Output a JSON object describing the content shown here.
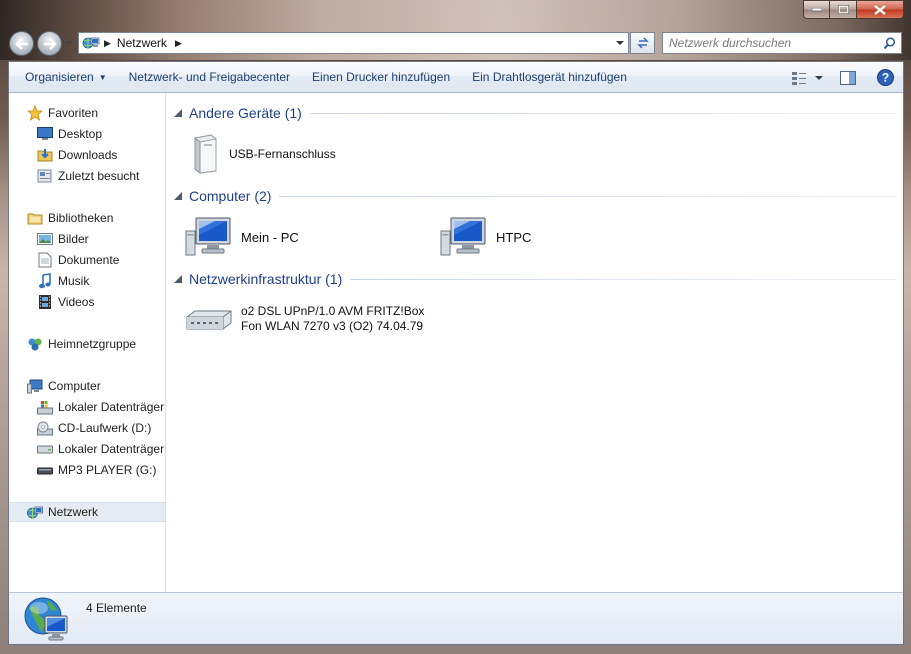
{
  "window": {
    "caption_buttons": [
      "minimize",
      "maximize",
      "close"
    ]
  },
  "address_bar": {
    "location": "Netzwerk"
  },
  "search": {
    "placeholder": "Netzwerk durchsuchen"
  },
  "command_bar": {
    "organize": "Organisieren",
    "network_sharing": "Netzwerk- und Freigabecenter",
    "add_printer": "Einen Drucker hinzufügen",
    "add_wireless": "Ein Drahtlosgerät hinzufügen"
  },
  "nav_pane": {
    "favorites": {
      "label": "Favoriten",
      "items": [
        {
          "label": "Desktop",
          "icon": "desktop-icon"
        },
        {
          "label": "Downloads",
          "icon": "downloads-icon"
        },
        {
          "label": "Zuletzt besucht",
          "icon": "recent-places-icon"
        }
      ]
    },
    "libraries": {
      "label": "Bibliotheken",
      "items": [
        {
          "label": "Bilder",
          "icon": "pictures-icon"
        },
        {
          "label": "Dokumente",
          "icon": "documents-icon"
        },
        {
          "label": "Musik",
          "icon": "music-icon"
        },
        {
          "label": "Videos",
          "icon": "videos-icon"
        }
      ]
    },
    "homegroup": {
      "label": "Heimnetzgruppe"
    },
    "computer": {
      "label": "Computer",
      "items": [
        {
          "label": "Lokaler Datenträger",
          "icon": "windows-drive-icon"
        },
        {
          "label": "CD-Laufwerk (D:)",
          "icon": "cd-drive-icon"
        },
        {
          "label": "Lokaler Datenträger",
          "icon": "hard-drive-icon"
        },
        {
          "label": "MP3 PLAYER (G:)",
          "icon": "removable-drive-icon"
        }
      ]
    },
    "network": {
      "label": "Netzwerk",
      "selected": true
    }
  },
  "content": {
    "groups": [
      {
        "title": "Andere Geräte (1)",
        "items": [
          {
            "label": "USB-Fernanschluss",
            "icon": "usb-device-icon"
          }
        ]
      },
      {
        "title": "Computer (2)",
        "items": [
          {
            "label": "Mein - PC",
            "icon": "computer-icon"
          },
          {
            "label": "HTPC",
            "icon": "computer-icon"
          }
        ]
      },
      {
        "title": "Netzwerkinfrastruktur (1)",
        "items": [
          {
            "label_line1": "o2 DSL UPnP/1.0 AVM FRITZ!Box",
            "label_line2": "Fon WLAN 7270 v3 (O2) 74.04.79",
            "icon": "router-icon"
          }
        ]
      }
    ]
  },
  "status_bar": {
    "count": "4 Elemente"
  },
  "colors": {
    "group_title": "#1e3f8a",
    "command_text": "#1e3f6e",
    "selection": "#e5ebf2"
  }
}
